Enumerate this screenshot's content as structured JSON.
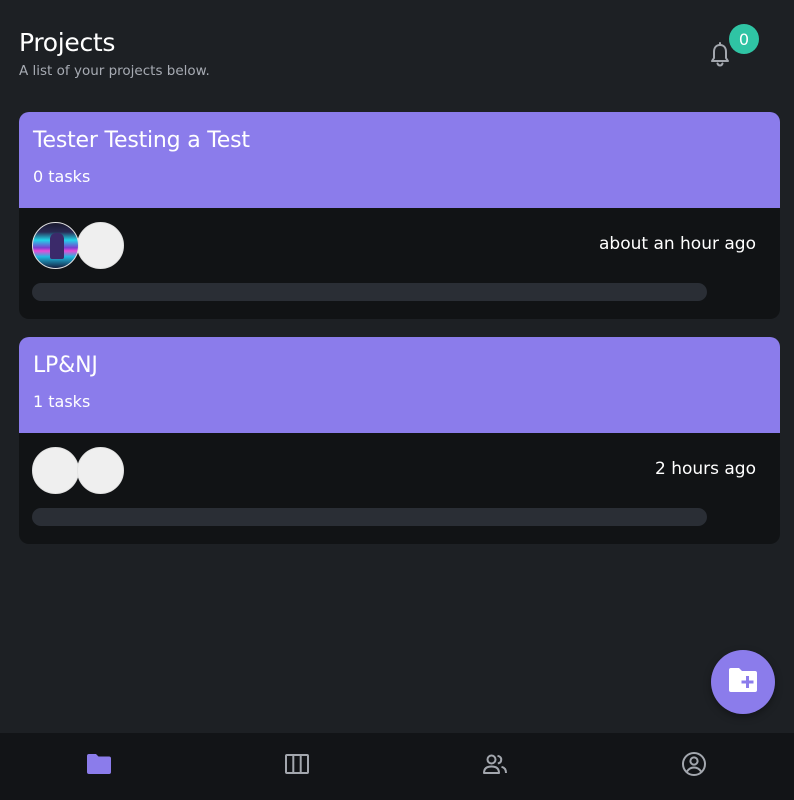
{
  "header": {
    "title": "Projects",
    "subtitle": "A list of your projects below."
  },
  "notifications": {
    "icon": "bell-icon",
    "count": "0"
  },
  "projects": [
    {
      "name": "Tester Testing a Test",
      "task_count": "0 tasks",
      "updated": "about an hour ago",
      "progress": 0,
      "avatars": [
        "user-photo-avatar",
        "blank-avatar"
      ]
    },
    {
      "name": "LP&NJ",
      "task_count": "1 tasks",
      "updated": "2 hours ago",
      "progress": 0,
      "avatars": [
        "blank-avatar",
        "blank-avatar"
      ]
    }
  ],
  "fab": {
    "icon": "folder-plus-icon"
  },
  "bottom_nav": [
    {
      "icon": "folder-icon",
      "active": true
    },
    {
      "icon": "board-columns-icon",
      "active": false
    },
    {
      "icon": "people-icon",
      "active": false
    },
    {
      "icon": "account-circle-icon",
      "active": false
    }
  ],
  "colors": {
    "background": "#1d2024",
    "accent": "#8b7ceb",
    "badge": "#2fc4a4",
    "card_body": "#111315",
    "nav_inactive": "#a3a7ae"
  }
}
